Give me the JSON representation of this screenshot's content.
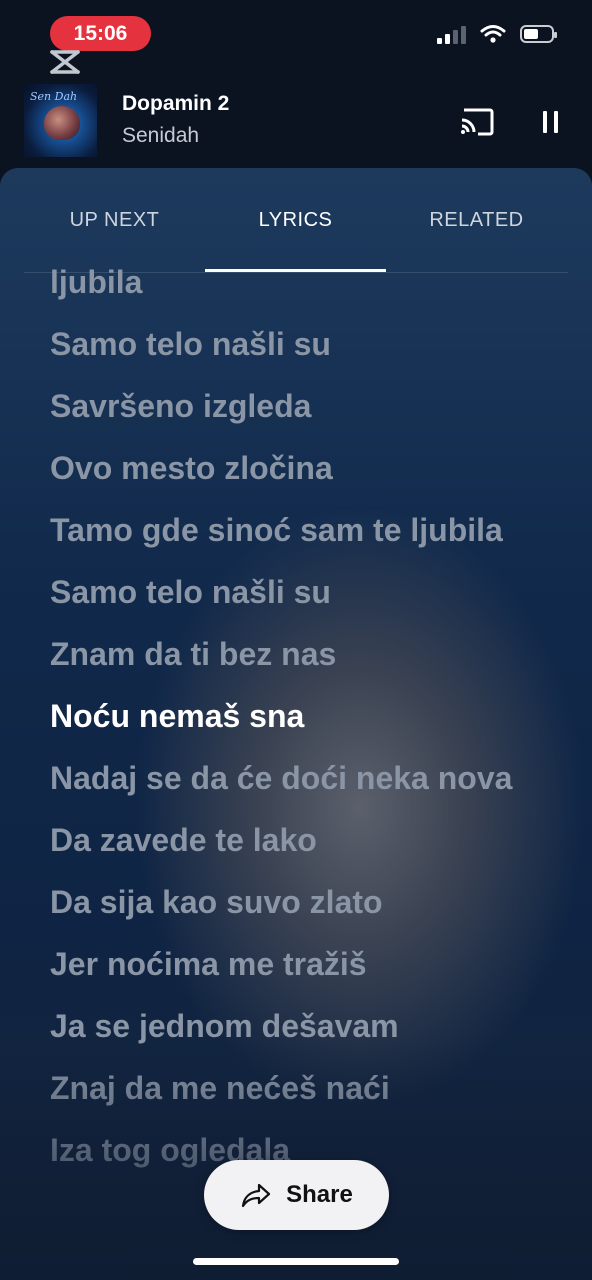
{
  "status_bar": {
    "time": "15:06"
  },
  "now_playing": {
    "title": "Dopamin 2",
    "artist": "Senidah",
    "art_script": "Sen Dah"
  },
  "tabs": [
    {
      "label": "UP NEXT",
      "active": false
    },
    {
      "label": "LYRICS",
      "active": true
    },
    {
      "label": "RELATED",
      "active": false
    }
  ],
  "lyrics": {
    "lines": [
      "ljubila",
      "Samo telo našli su",
      "Savršeno izgleda",
      "Ovo mesto zločina",
      "Tamo gde sinoć sam te ljubila",
      "Samo telo našli su",
      "Znam da ti bez nas",
      "Noću nemaš sna",
      "Nadaj se da će doći neka nova",
      "Da zavede te lako",
      "Da sija kao suvo zlato",
      "Jer noćima me tražiš",
      "Ja se jednom dešavam",
      "Znaj da me nećeš naći",
      "Iza tog ogledala"
    ],
    "current_index": 7
  },
  "share": {
    "label": "Share"
  },
  "colors": {
    "accent_pill": "#e5323f",
    "lyric_dim": "#8a95a6",
    "lyric_current": "#ffffff"
  }
}
